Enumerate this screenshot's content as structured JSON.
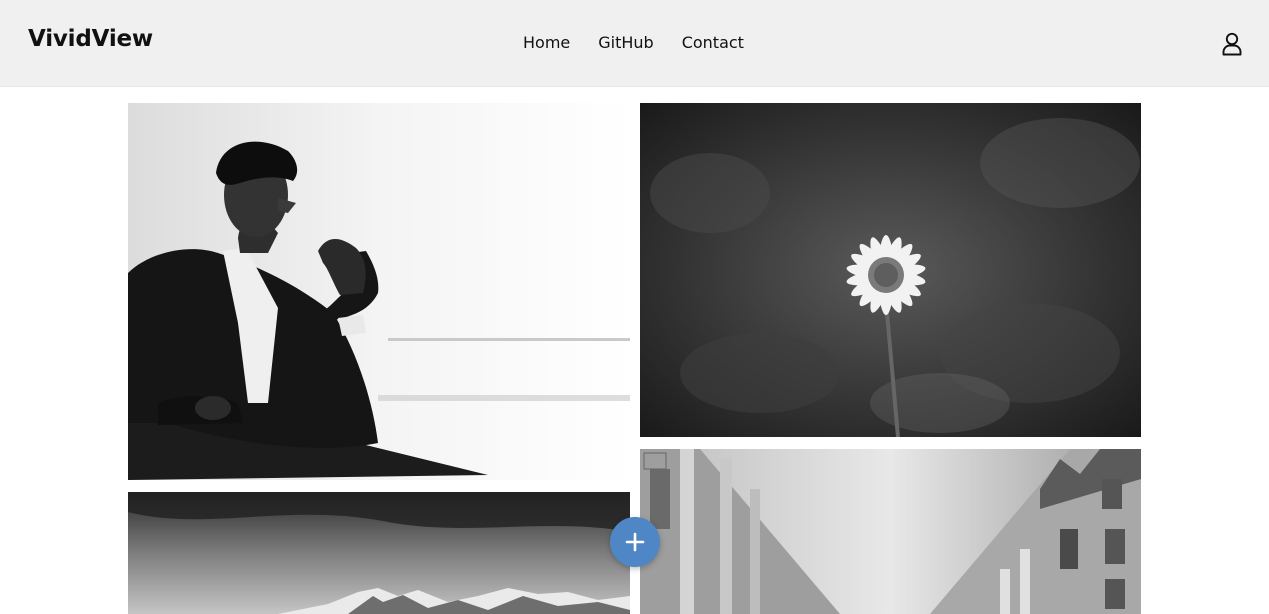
{
  "header": {
    "logo": "VividView",
    "nav": [
      {
        "label": "Home"
      },
      {
        "label": "GitHub"
      },
      {
        "label": "Contact"
      }
    ],
    "account_icon": "user-icon"
  },
  "gallery": {
    "images": [
      {
        "name": "man-portrait",
        "alt": "Man seated in suit, black and white"
      },
      {
        "name": "flower",
        "alt": "Daisy flower, black and white"
      },
      {
        "name": "mountains",
        "alt": "Snowy mountain range under clouds"
      },
      {
        "name": "street",
        "alt": "City street with classical buildings"
      }
    ]
  },
  "fab": {
    "icon": "plus-icon",
    "color": "#4f86c6"
  },
  "colors": {
    "header_bg": "#f0f0f0",
    "accent": "#4f86c6",
    "text": "#111111"
  }
}
